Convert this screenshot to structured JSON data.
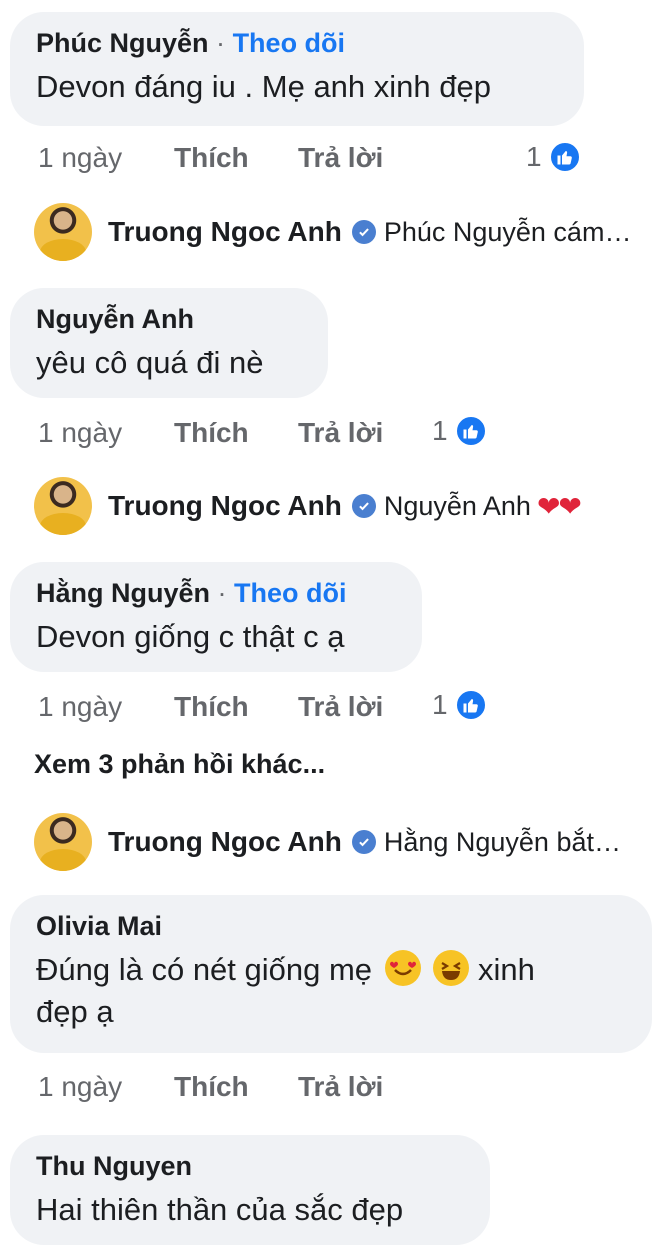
{
  "comments": [
    {
      "author": "Phúc Nguyễn",
      "separator": "·",
      "follow_label": "Theo dõi",
      "text": "Devon đáng iu . Mẹ anh xinh đẹp",
      "age": "1 ngày",
      "like_label": "Thích",
      "reply_label": "Trả lời",
      "reaction_count": "1",
      "reply": {
        "name": "Truong Ngoc Anh",
        "text": "Phúc Nguyễn cám…"
      }
    },
    {
      "author": "Nguyễn Anh",
      "text": "yêu cô quá đi nè",
      "age": "1 ngày",
      "like_label": "Thích",
      "reply_label": "Trả lời",
      "reaction_count": "1",
      "reply": {
        "name": "Truong Ngoc Anh",
        "text": "Nguyễn Anh",
        "hearts": "❤❤"
      }
    },
    {
      "author": "Hằng Nguyễn",
      "separator": "·",
      "follow_label": "Theo dõi",
      "text": "Devon giống c thật c ạ",
      "age": "1 ngày",
      "like_label": "Thích",
      "reply_label": "Trả lời",
      "reaction_count": "1",
      "more_replies": "Xem 3 phản hồi khác...",
      "reply": {
        "name": "Truong Ngoc Anh",
        "text": "Hằng Nguyễn bắt…"
      }
    },
    {
      "author": "Olivia Mai",
      "text_line1": "Đúng là có nét giống mẹ",
      "text_line1_end": "xinh",
      "text_line2": "đẹp ạ",
      "age": "1 ngày",
      "like_label": "Thích",
      "reply_label": "Trả lời"
    },
    {
      "author": "Thu Nguyen",
      "text": "Hai thiên thần của sắc đẹp"
    }
  ],
  "colors": {
    "bubble": "#f0f2f5",
    "link": "#1877f2",
    "meta": "#65676b",
    "like": "#1877f2",
    "heart": "#e0243a"
  },
  "icons": [
    "like-reaction-icon",
    "verified-badge-icon",
    "smiling-hearts-emoji",
    "laughing-emoji"
  ]
}
